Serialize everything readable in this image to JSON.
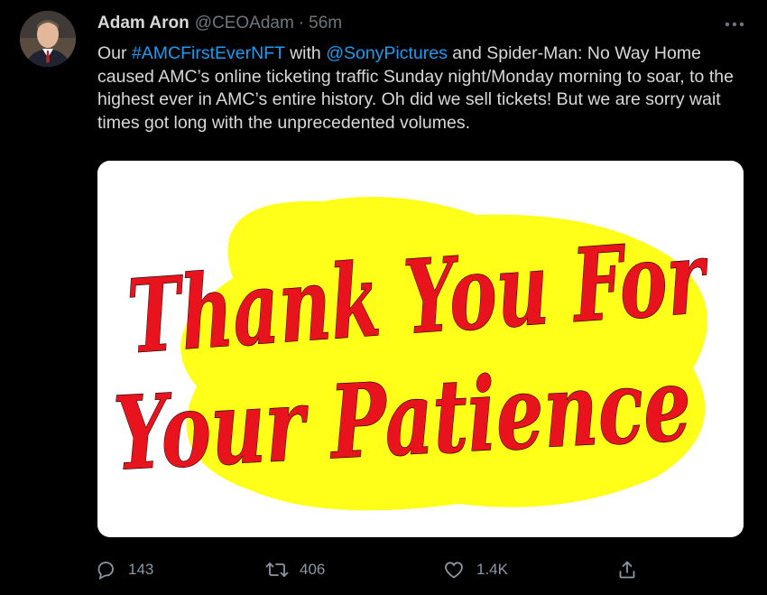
{
  "tweet": {
    "author_name": "Adam Aron",
    "author_handle": "@CEOAdam",
    "separator": "·",
    "timestamp": "56m",
    "text_parts": {
      "p1": "Our ",
      "hashtag": "#AMCFirstEverNFT",
      "p2": " with ",
      "mention": "@SonyPictures",
      "p3": " and Spider-Man: No Way Home caused AMC’s online ticketing traffic Sunday night/Monday morning to soar, to the highest ever in AMC’s entire history. Oh did we sell tickets! But we are sorry wait times got long with the unprecedented volumes."
    },
    "media": {
      "line1": "Thank You For",
      "line2": "Your Patience",
      "text_color": "#e8131c",
      "blob_color": "#ffff1a"
    },
    "actions": {
      "reply_count": "143",
      "retweet_count": "406",
      "like_count": "1.4K"
    },
    "icons": {
      "more": "more-dots-icon",
      "reply": "reply-icon",
      "retweet": "retweet-icon",
      "like": "heart-icon",
      "share": "share-icon"
    },
    "colors": {
      "background": "#000000",
      "link": "#1d9bf0",
      "text": "#d9d9d9",
      "muted": "#6e767d"
    }
  }
}
